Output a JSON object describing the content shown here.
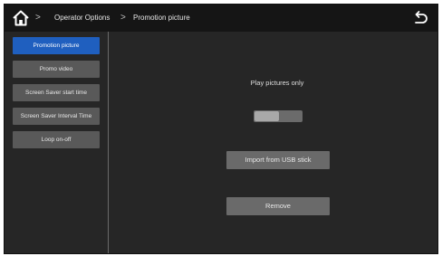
{
  "header": {
    "breadcrumb": [
      "Operator Options",
      "Promotion picture"
    ],
    "separator": ">"
  },
  "sidebar": {
    "items": [
      {
        "label": "Promotion picture",
        "active": true
      },
      {
        "label": "Promo video",
        "active": false
      },
      {
        "label": "Screen Saver start time",
        "active": false
      },
      {
        "label": "Screen Saver Interval Time",
        "active": false
      },
      {
        "label": "Loop on-off",
        "active": false
      }
    ]
  },
  "main": {
    "play_label": "Play pictures only",
    "toggle_state": "off",
    "import_label": "Import from USB stick",
    "remove_label": "Remove"
  },
  "icons": {
    "home": "home-icon",
    "back": "back-arrow-icon"
  },
  "colors": {
    "active_item": "#1f5fbf",
    "button": "#6a6a6a"
  }
}
